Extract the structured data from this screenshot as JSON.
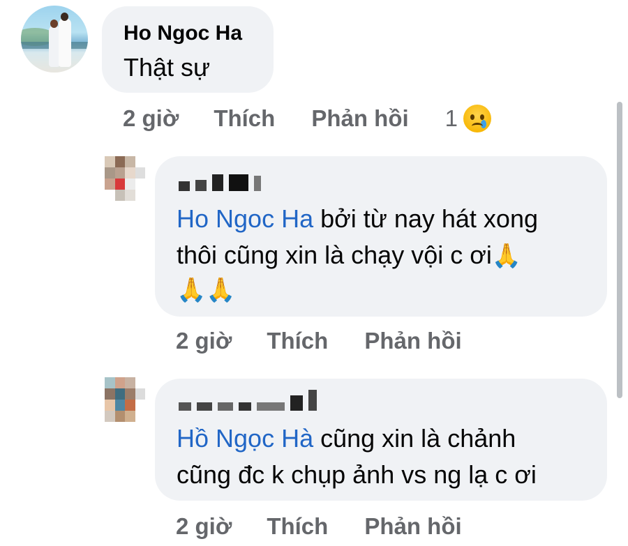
{
  "comments": [
    {
      "author": "Ho Ngoc Ha",
      "text": "Thật sự",
      "time": "2 giờ",
      "like_label": "Thích",
      "reply_label": "Phản hồi",
      "reaction_count": "1",
      "reaction_icon": "crying-face-icon"
    },
    {
      "author": "",
      "mention": "Ho Ngoc Ha",
      "text_line1": " bởi từ nay hát xong",
      "text_line2": "thôi cũng xin là chạy vội c ơi",
      "emoji": "🙏",
      "emoji_line3": "🙏🙏",
      "time": "2 giờ",
      "like_label": "Thích",
      "reply_label": "Phản hồi"
    },
    {
      "author": "",
      "mention": "Hồ Ngọc Hà",
      "text_line1": " cũng xin là chảnh",
      "text_line2": "cũng đc k chụp ảnh vs ng lạ c ơi",
      "time": "2 giờ",
      "like_label": "Thích",
      "reply_label": "Phản hồi"
    }
  ],
  "colors": {
    "bubble": "#f0f2f5",
    "mention": "#2166c6",
    "meta": "#65676b",
    "scrollbar": "#bcc0c4"
  }
}
